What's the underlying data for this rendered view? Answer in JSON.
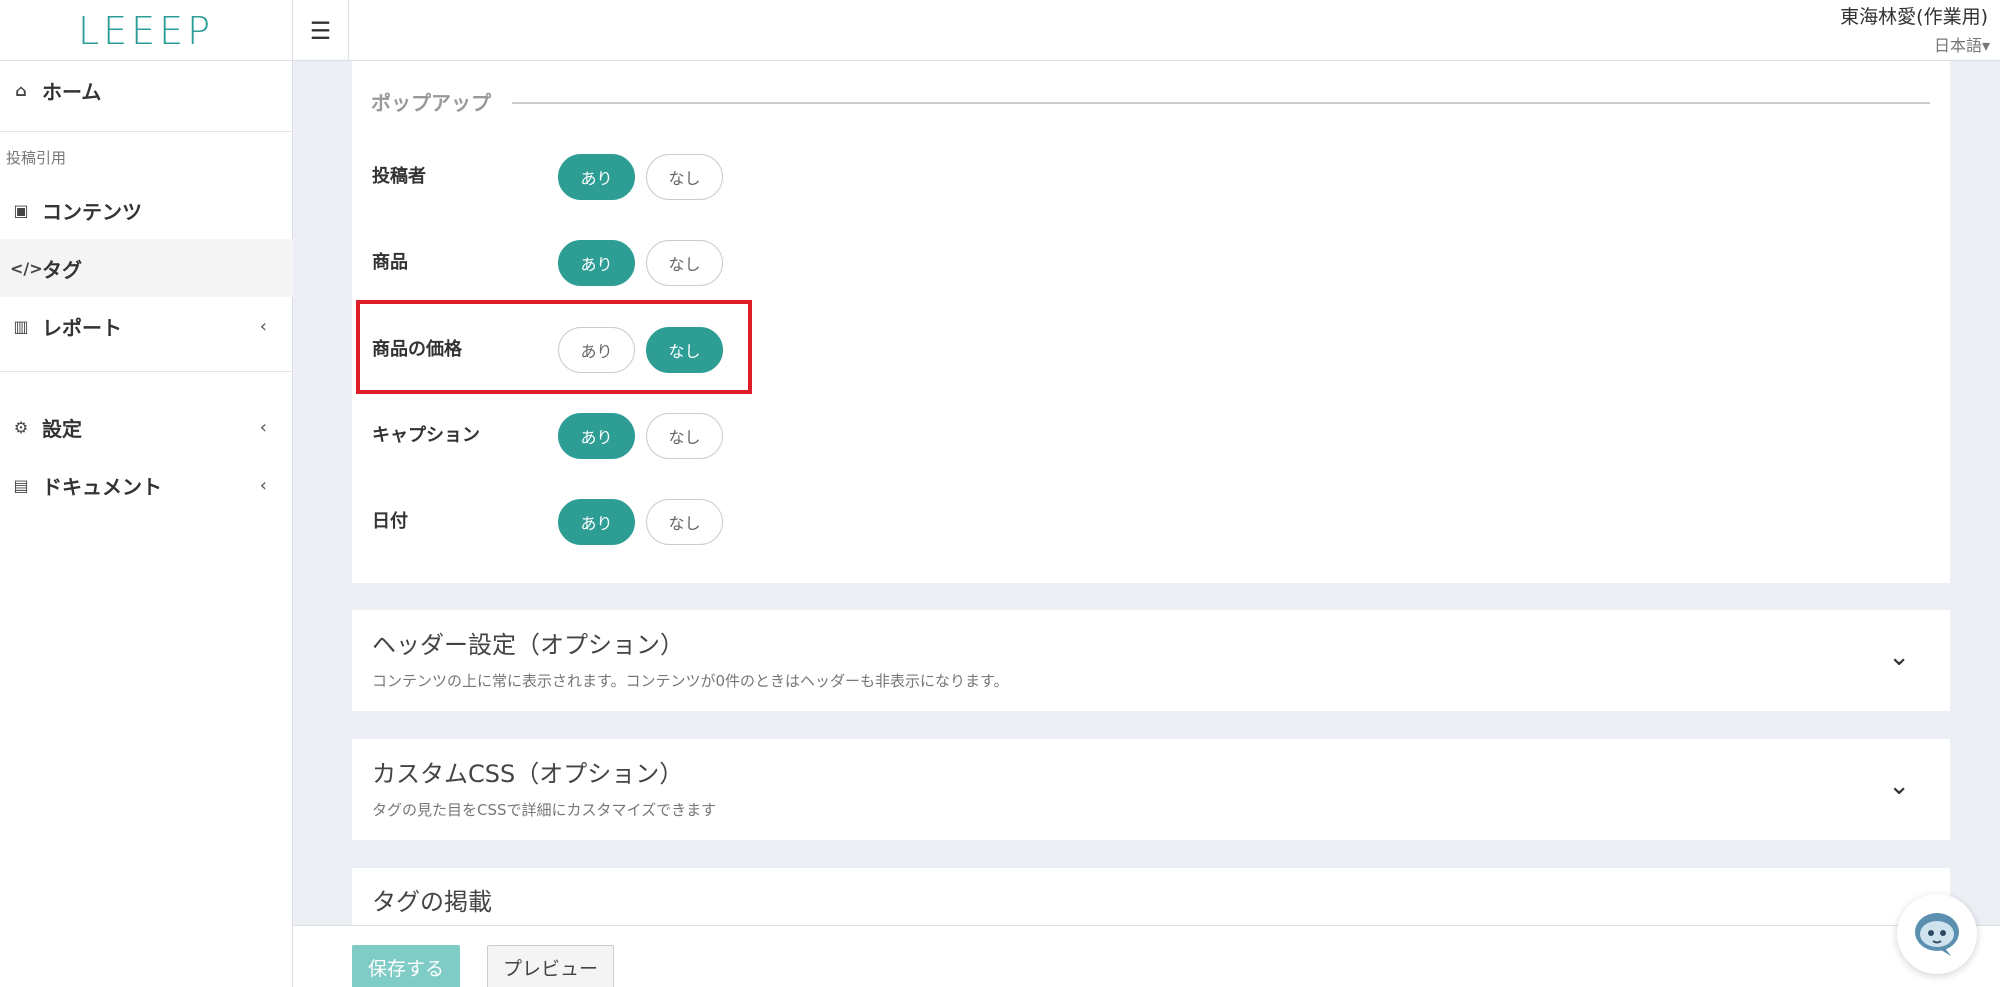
{
  "app": {
    "logo": "LEEEP",
    "menu_icon": "hamburger-icon"
  },
  "header": {
    "user": "東海林愛(作業用)",
    "language": "日本語▾"
  },
  "sidebar": {
    "home": {
      "label": "ホーム",
      "icon": "home-icon"
    },
    "section": "投稿引用",
    "items": [
      {
        "label": "コンテンツ",
        "icon": "image-icon"
      },
      {
        "label": "タグ",
        "icon": "code-icon"
      },
      {
        "label": "レポート",
        "icon": "bar-chart-icon",
        "chevron": "‹"
      }
    ],
    "bottom": [
      {
        "label": "設定",
        "icon": "gear-icon",
        "chevron": "‹"
      },
      {
        "label": "ドキュメント",
        "icon": "document-icon",
        "chevron": "‹"
      }
    ]
  },
  "popup": {
    "legend": "ポップアップ",
    "on_label": "あり",
    "off_label": "なし",
    "rows": [
      {
        "label": "投稿者",
        "value": "あり"
      },
      {
        "label": "商品",
        "value": "あり"
      },
      {
        "label": "商品の価格",
        "value": "なし"
      },
      {
        "label": "キャプション",
        "value": "あり"
      },
      {
        "label": "日付",
        "value": "あり"
      }
    ]
  },
  "cards": [
    {
      "title": "ヘッダー設定（オプション）",
      "subtitle": "コンテンツの上に常に表示されます。コンテンツが0件のときはヘッダーも非表示になります。"
    },
    {
      "title": "カスタムCSS（オプション）",
      "subtitle": "タグの見た目をCSSで詳細にカスタマイズできます"
    },
    {
      "title": "タグの掲載",
      "subtitle": ""
    }
  ],
  "footer": {
    "save": "保存する",
    "preview": "プレビュー"
  },
  "colors": {
    "accent": "#2e9e95",
    "highlight": "#e01e2b"
  }
}
